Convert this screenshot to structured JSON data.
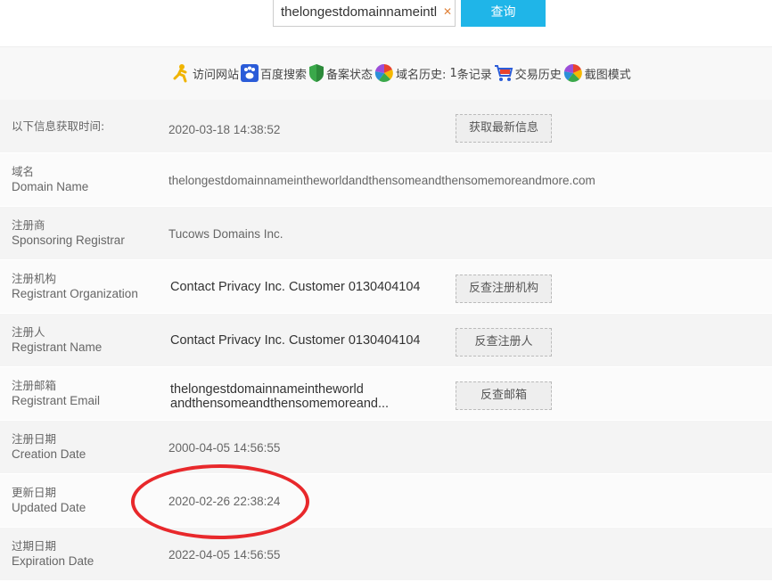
{
  "search": {
    "value": "thelongestdomainnameintl",
    "button_label": "查询"
  },
  "links": {
    "visit": "访问网站",
    "baidu": "百度搜索",
    "beian": "备案状态",
    "history_prefix": "域名历史: ",
    "history_count": "1",
    "history_suffix": " 条记录",
    "trade": "交易历史",
    "screenshot": "截图模式"
  },
  "fetch_row": {
    "label": "以下信息获取时间:",
    "value": "2020-03-18 14:38:52",
    "action": "获取最新信息"
  },
  "rows": [
    {
      "zh": "域名",
      "en": "Domain Name",
      "value": "thelongestdomainnameintheworldandthensomeandthensomemoreandmore.com"
    },
    {
      "zh": "注册商",
      "en": "Sponsoring Registrar",
      "value": "Tucows Domains Inc."
    },
    {
      "zh": "注册机构",
      "en": "Registrant Organization",
      "value": "Contact Privacy Inc. Customer 0130404104",
      "action": "反查注册机构"
    },
    {
      "zh": "注册人",
      "en": "Registrant Name",
      "value": "Contact Privacy Inc. Customer 0130404104",
      "action": "反查注册人"
    },
    {
      "zh": "注册邮箱",
      "en": "Registrant Email",
      "value_line1": "thelongestdomainnameintheworld",
      "value_line2": "andthensomeandthensomemoreand...",
      "action": "反查邮箱"
    },
    {
      "zh": "注册日期",
      "en": "Creation Date",
      "value": "2000-04-05 14:56:55"
    },
    {
      "zh": "更新日期",
      "en": "Updated Date",
      "value": "2020-02-26 22:38:24"
    },
    {
      "zh": "过期日期",
      "en": "Expiration Date",
      "value": "2022-04-05 14:56:55"
    }
  ],
  "colors": {
    "search_button": "#1fb5e8",
    "highlight_circle": "#e8282b"
  }
}
